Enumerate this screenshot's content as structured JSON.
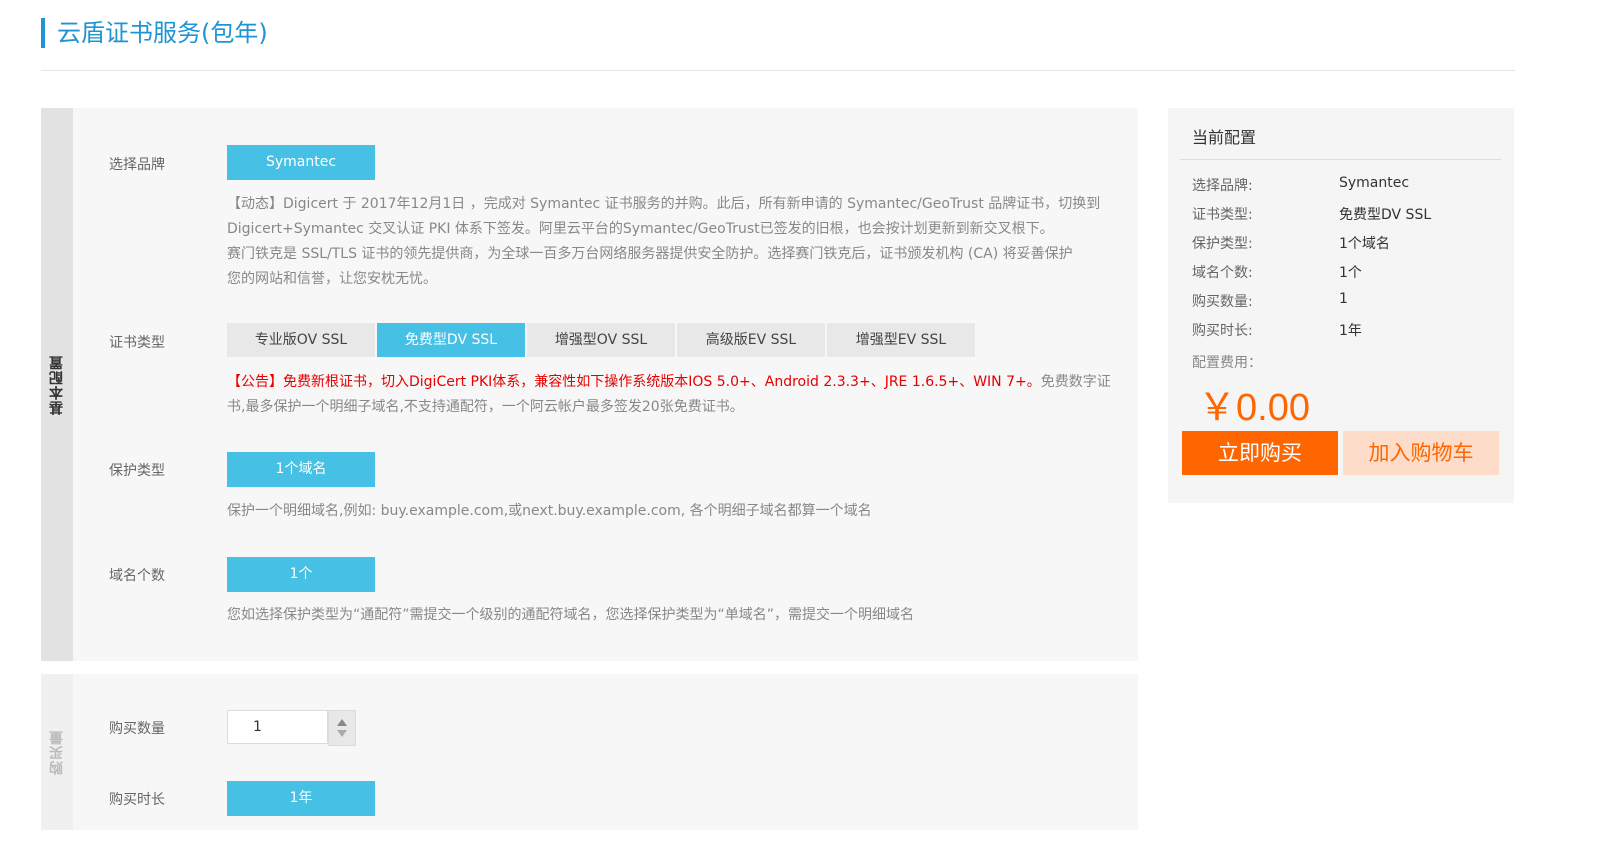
{
  "page": {
    "title": "云盾证书服务(包年)"
  },
  "basic": {
    "side_label": "基本配置",
    "brand": {
      "label": "选择品牌",
      "button": "Symantec",
      "desc_lines": [
        "【动态】Digicert 于 2017年12月1日 ，完成对 Symantec 证书服务的并购。此后，所有新申请的 Symantec/GeoTrust 品牌证书，切换到",
        "Digicert+Symantec 交叉认证 PKI 体系下签发。阿里云平台的Symantec/GeoTrust已签发的旧根，也会按计划更新到新交叉根下。",
        "赛门铁克是 SSL/TLS 证书的领先提供商，为全球一百多万台网络服务器提供安全防护。选择赛门铁克后，证书颁发机构 (CA) 将妥善保护",
        "您的网站和信誉，让您安枕无忧。"
      ]
    },
    "cert_type": {
      "label": "证书类型",
      "tabs": [
        "专业版OV SSL",
        "免费型DV SSL",
        "增强型OV SSL",
        "高级版EV SSL",
        "增强型EV SSL"
      ],
      "selected": "免费型DV SSL",
      "notice_red": "【公告】免费新根证书，切入DigiCert PKI体系，兼容性如下操作系统版本IOS 5.0+、Android 2.3.3+、JRE 1.6.5+、WIN 7+。",
      "notice_rest_1": "免费数字证",
      "notice_rest_2": "书,最多保护一个明细子域名,不支持通配符，一个阿云帐户最多签发20张免费证书。"
    },
    "protect": {
      "label": "保护类型",
      "button": "1个域名",
      "desc": "保护一个明细域名,例如: buy.example.com,或next.buy.example.com, 各个明细子域名都算一个域名"
    },
    "domains": {
      "label": "域名个数",
      "button": "1个",
      "desc": "您如选择保护类型为“通配符”需提交一个级别的通配符域名，您选择保护类型为“单域名”，需提交一个明细域名"
    }
  },
  "purchase": {
    "side_label": "购买量",
    "quantity": {
      "label": "购买数量",
      "value": "1"
    },
    "duration": {
      "label": "购买时长",
      "button": "1年"
    }
  },
  "summary": {
    "title": "当前配置",
    "rows": [
      {
        "k": "选择品牌:",
        "v": "Symantec"
      },
      {
        "k": "证书类型:",
        "v": "免费型DV SSL"
      },
      {
        "k": "保护类型:",
        "v": "1个域名"
      },
      {
        "k": "域名个数:",
        "v": "1个"
      },
      {
        "k": "购买数量:",
        "v": "1"
      },
      {
        "k": "购买时长:",
        "v": "1年"
      }
    ],
    "fee_label": "配置费用：",
    "price": "￥0.00",
    "buy_now": "立即购买",
    "add_cart": "加入购物车"
  },
  "colors": {
    "accent": "#46c0e4",
    "title_blue": "#1f94d4",
    "orange": "#ff6600",
    "notice_red": "#e60000"
  }
}
